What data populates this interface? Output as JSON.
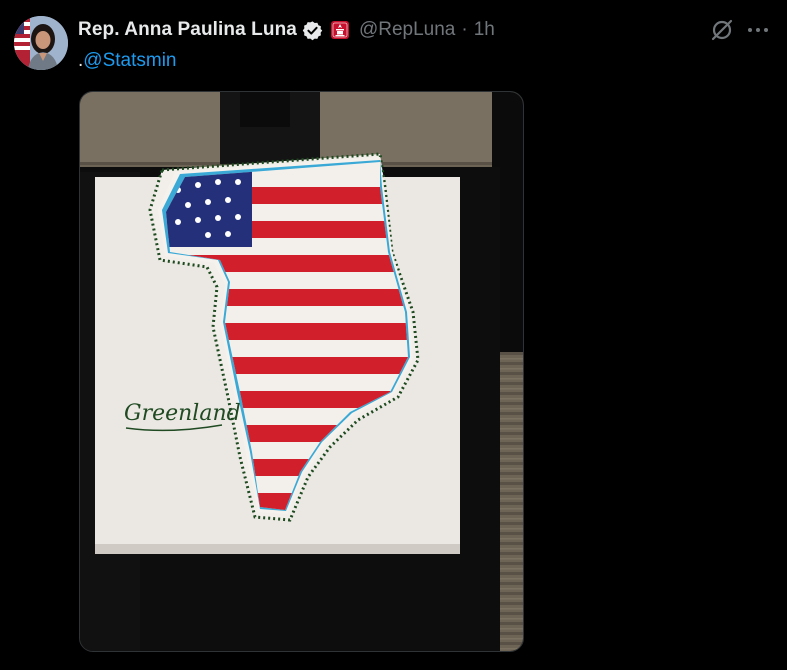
{
  "author": {
    "display_name": "Rep. Anna Paulina Luna",
    "handle": "@RepLuna",
    "separator": "·",
    "time": "1h"
  },
  "tweet": {
    "prefix": ".",
    "mention": "@Statsmin"
  },
  "media": {
    "cake_inscription": "Greenland"
  },
  "colors": {
    "background": "#000000",
    "text": "#e7e9ea",
    "secondary": "#71767b",
    "link": "#1d9bf0",
    "verified_badge": "#e7e9ea",
    "affiliation_badge": "#c8102e"
  },
  "icons": {
    "verified": "verified-check-icon",
    "affiliation": "us-house-badge-icon",
    "grok": "grok-icon",
    "more": "more-dots-icon"
  }
}
